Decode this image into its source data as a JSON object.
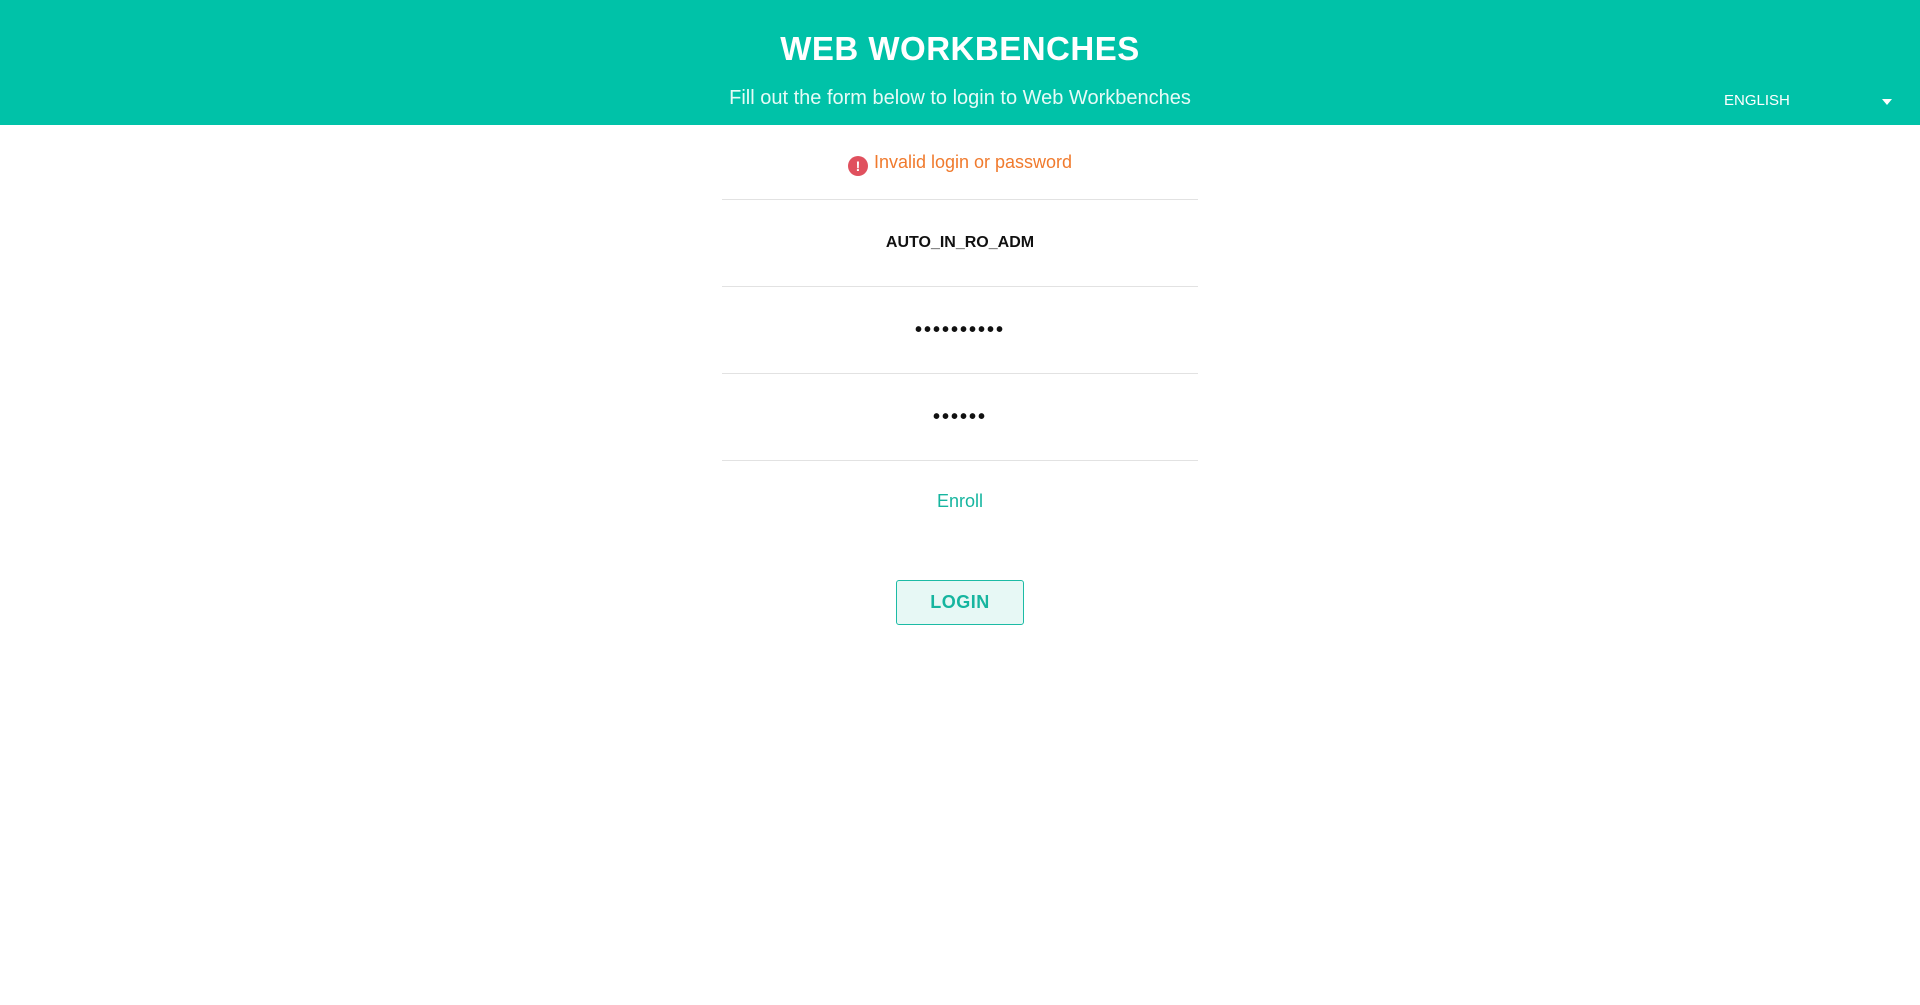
{
  "header": {
    "title": "WEB WORKBENCHES",
    "subtitle": "Fill out the form below to login to Web Workbenches",
    "background_color": "#00c2a8"
  },
  "language_selector": {
    "selected": "ENGLISH",
    "icon": "chevron-down-icon"
  },
  "login_form": {
    "error": {
      "icon": "exclamation-circle-icon",
      "message": "Invalid login or password",
      "color": "#f07a2d"
    },
    "username": {
      "value": "AUTO_IN_RO_ADM"
    },
    "password": {
      "value": "••••••••••"
    },
    "second_password": {
      "value": "••••••"
    },
    "enroll_link": "Enroll",
    "login_button": "LOGIN"
  }
}
